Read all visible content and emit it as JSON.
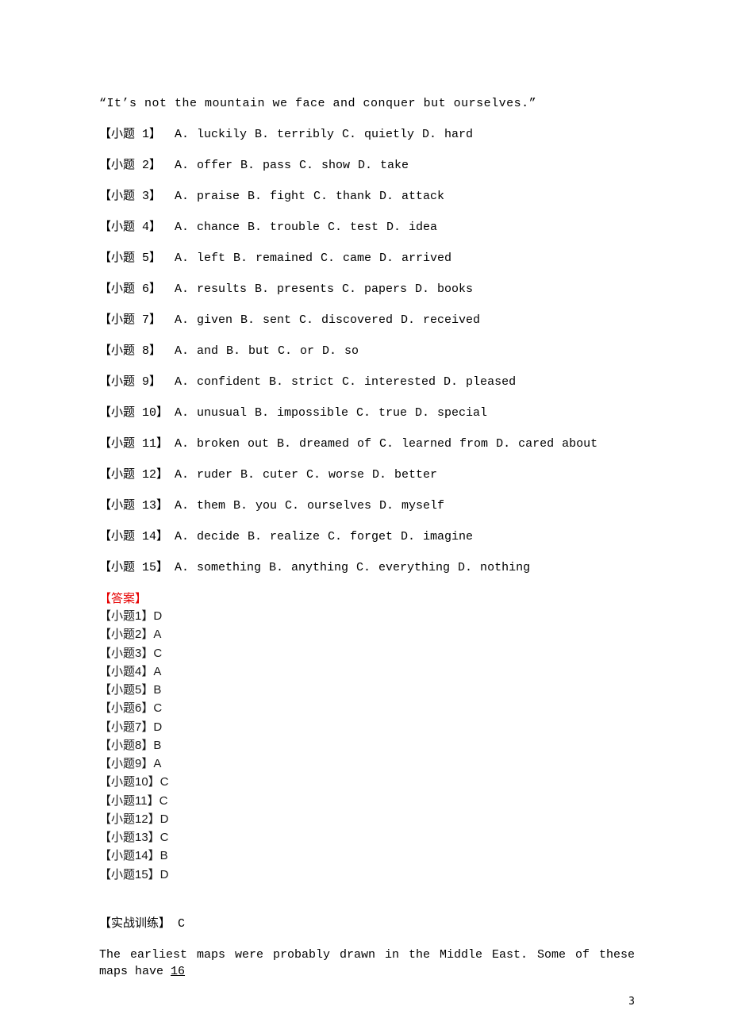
{
  "quote": "“It’s not the mountain we face and conquer but ourselves.”",
  "questions": [
    {
      "label": "【小题 1】",
      "opts": "A. luckily  B. terribly C. quietly  D. hard"
    },
    {
      "label": "【小题 2】",
      "opts": "A. offer   B. pass C. show D. take"
    },
    {
      "label": "【小题 3】",
      "opts": "A. praise  B. fight   C. thank   D. attack"
    },
    {
      "label": "【小题 4】",
      "opts": "A. chance  B. trouble  C. test D. idea"
    },
    {
      "label": "【小题 5】",
      "opts": "A. left B. remained C. came D. arrived"
    },
    {
      "label": "【小题 6】",
      "opts": "A. results  B. presents C. papers  D. books"
    },
    {
      "label": "【小题 7】",
      "opts": "A. given   B. sent C. discovered  D. received"
    },
    {
      "label": "【小题 8】",
      "opts": "A. and  B. but  C. or  D. so"
    },
    {
      "label": "【小题 9】",
      "opts": "A. confident   B. strict  C. interested  D. pleased"
    },
    {
      "label": "【小题 10】",
      "opts": "A. unusual  B. impossible  C. true D. special"
    },
    {
      "label": "【小题 11】",
      "opts": "A. broken out  B. dreamed of  C. learned from D. cared about"
    },
    {
      "label": "【小题 12】",
      "opts": "A. ruder   B. cuter   C. worse   D. better"
    },
    {
      "label": "【小题 13】",
      "opts": "A. them B. you  C. ourselves   D. myself"
    },
    {
      "label": "【小题 14】",
      "opts": "A. decide  B. realize  C. forget  D. imagine"
    },
    {
      "label": "【小题 15】",
      "opts": "A. something   B. anything C. everything  D. nothing"
    }
  ],
  "answers_header": "【答案】",
  "answers": [
    "【小题1】D",
    "【小题2】A",
    "【小题3】C",
    "【小题4】A",
    "【小题5】B",
    "【小题6】C",
    "【小题7】D",
    "【小题8】B",
    "【小题9】A",
    "【小题10】C",
    "【小题11】C",
    "【小题12】D",
    "【小题13】C",
    "【小题14】B",
    "【小题15】D"
  ],
  "practice_heading": "【实战训练】 C",
  "passage_prefix": "The earliest maps were probably drawn in the Middle East. Some of these maps have  ",
  "passage_blank": "  16  ",
  "page_number": "3"
}
